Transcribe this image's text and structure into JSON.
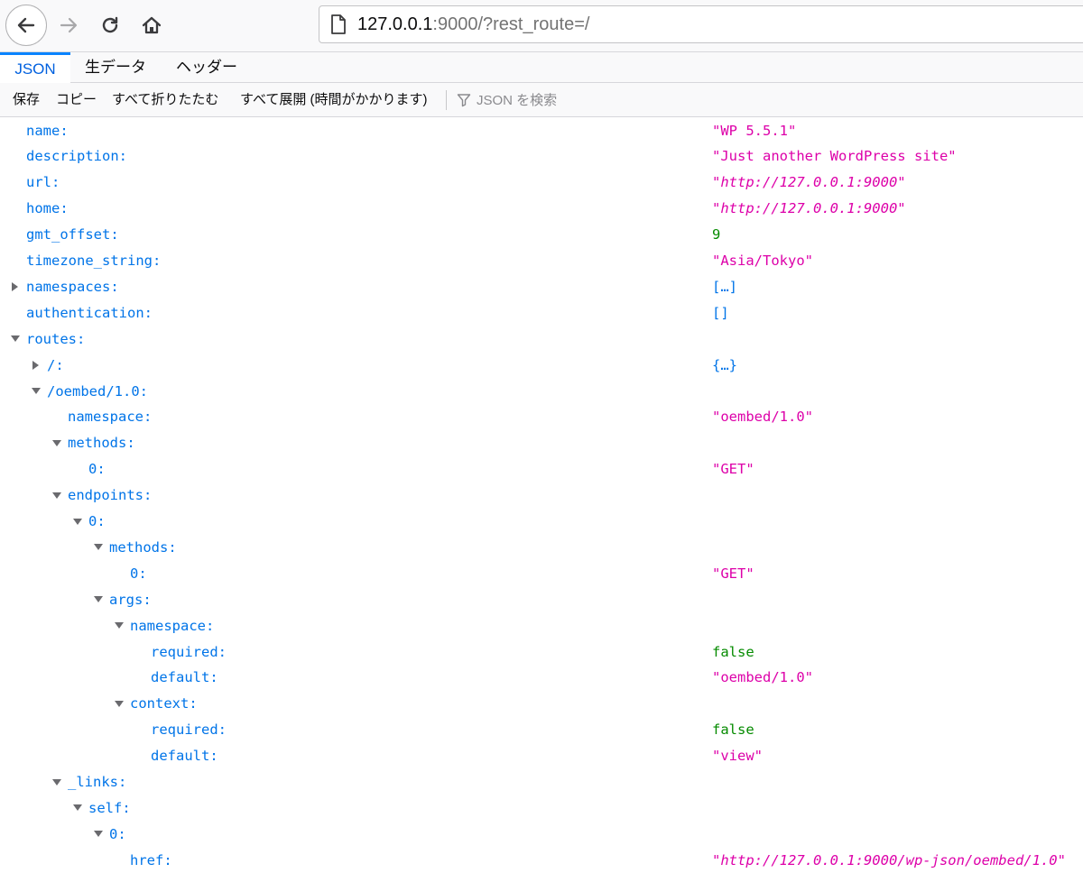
{
  "browser": {
    "url_host": "127.0.0.1",
    "url_rest": ":9000/?rest_route=/"
  },
  "tabs": [
    {
      "label": "JSON",
      "active": true
    },
    {
      "label": "生データ",
      "active": false
    },
    {
      "label": "ヘッダー",
      "active": false
    }
  ],
  "toolbar": {
    "save": "保存",
    "copy": "コピー",
    "collapse_all": "すべて折りたたむ",
    "expand_all": "すべて展開 (時間がかかります)",
    "filter_placeholder": "JSON を検索"
  },
  "colors": {
    "key": "#0074e8",
    "string": "#dd00a9",
    "number": "#058b00",
    "accent": "#0a84ff"
  },
  "rows": [
    {
      "key": "name:",
      "depth": 0,
      "twisty": "none",
      "value": "\"WP 5.5.1\"",
      "vtype": "string"
    },
    {
      "key": "description:",
      "depth": 0,
      "twisty": "none",
      "value": "\"Just another WordPress site\"",
      "vtype": "string"
    },
    {
      "key": "url:",
      "depth": 0,
      "twisty": "none",
      "value": "\"http://127.0.0.1:9000\"",
      "vtype": "url"
    },
    {
      "key": "home:",
      "depth": 0,
      "twisty": "none",
      "value": "\"http://127.0.0.1:9000\"",
      "vtype": "url"
    },
    {
      "key": "gmt_offset:",
      "depth": 0,
      "twisty": "none",
      "value": "9",
      "vtype": "number"
    },
    {
      "key": "timezone_string:",
      "depth": 0,
      "twisty": "none",
      "value": "\"Asia/Tokyo\"",
      "vtype": "string"
    },
    {
      "key": "namespaces:",
      "depth": 0,
      "twisty": "collapsed",
      "value": "[…]",
      "vtype": "obj"
    },
    {
      "key": "authentication:",
      "depth": 0,
      "twisty": "none",
      "value": "[]",
      "vtype": "obj"
    },
    {
      "key": "routes:",
      "depth": 0,
      "twisty": "expanded",
      "value": "",
      "vtype": "obj"
    },
    {
      "key": "/:",
      "depth": 1,
      "twisty": "collapsed",
      "value": "{…}",
      "vtype": "obj"
    },
    {
      "key": "/oembed/1.0:",
      "depth": 1,
      "twisty": "expanded",
      "value": "",
      "vtype": "obj"
    },
    {
      "key": "namespace:",
      "depth": 2,
      "twisty": "none",
      "value": "\"oembed/1.0\"",
      "vtype": "string"
    },
    {
      "key": "methods:",
      "depth": 2,
      "twisty": "expanded",
      "value": "",
      "vtype": "obj"
    },
    {
      "key": "0:",
      "depth": 3,
      "twisty": "none",
      "value": "\"GET\"",
      "vtype": "string"
    },
    {
      "key": "endpoints:",
      "depth": 2,
      "twisty": "expanded",
      "value": "",
      "vtype": "obj"
    },
    {
      "key": "0:",
      "depth": 3,
      "twisty": "expanded",
      "value": "",
      "vtype": "obj"
    },
    {
      "key": "methods:",
      "depth": 4,
      "twisty": "expanded",
      "value": "",
      "vtype": "obj"
    },
    {
      "key": "0:",
      "depth": 5,
      "twisty": "none",
      "value": "\"GET\"",
      "vtype": "string"
    },
    {
      "key": "args:",
      "depth": 4,
      "twisty": "expanded",
      "value": "",
      "vtype": "obj"
    },
    {
      "key": "namespace:",
      "depth": 5,
      "twisty": "expanded",
      "value": "",
      "vtype": "obj"
    },
    {
      "key": "required:",
      "depth": 6,
      "twisty": "none",
      "value": "false",
      "vtype": "bool"
    },
    {
      "key": "default:",
      "depth": 6,
      "twisty": "none",
      "value": "\"oembed/1.0\"",
      "vtype": "string"
    },
    {
      "key": "context:",
      "depth": 5,
      "twisty": "expanded",
      "value": "",
      "vtype": "obj"
    },
    {
      "key": "required:",
      "depth": 6,
      "twisty": "none",
      "value": "false",
      "vtype": "bool"
    },
    {
      "key": "default:",
      "depth": 6,
      "twisty": "none",
      "value": "\"view\"",
      "vtype": "string"
    },
    {
      "key": "_links:",
      "depth": 2,
      "twisty": "expanded",
      "value": "",
      "vtype": "obj"
    },
    {
      "key": "self:",
      "depth": 3,
      "twisty": "expanded",
      "value": "",
      "vtype": "obj"
    },
    {
      "key": "0:",
      "depth": 4,
      "twisty": "expanded",
      "value": "",
      "vtype": "obj"
    },
    {
      "key": "href:",
      "depth": 5,
      "twisty": "none",
      "value": "\"http://127.0.0.1:9000/wp-json/oembed/1.0\"",
      "vtype": "url"
    }
  ]
}
